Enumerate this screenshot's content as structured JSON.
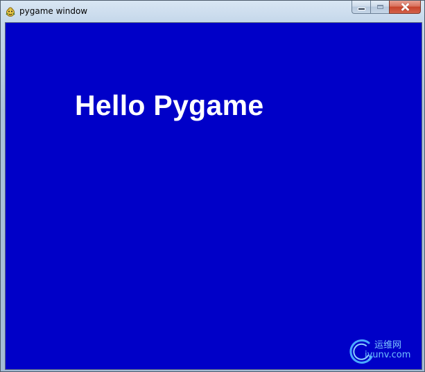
{
  "window": {
    "title": "pygame window",
    "icon": "pygame-snake-icon"
  },
  "caption_buttons": {
    "minimize_icon": "minimize-icon",
    "maximize_icon": "maximize-icon",
    "close_icon": "close-icon"
  },
  "client": {
    "background_color": "#0000C8",
    "text": "Hello Pygame",
    "text_color": "#FFFFFF"
  },
  "watermark": {
    "cn": "运维网",
    "en": "iyunv.com",
    "color": "#6FC0FF"
  }
}
